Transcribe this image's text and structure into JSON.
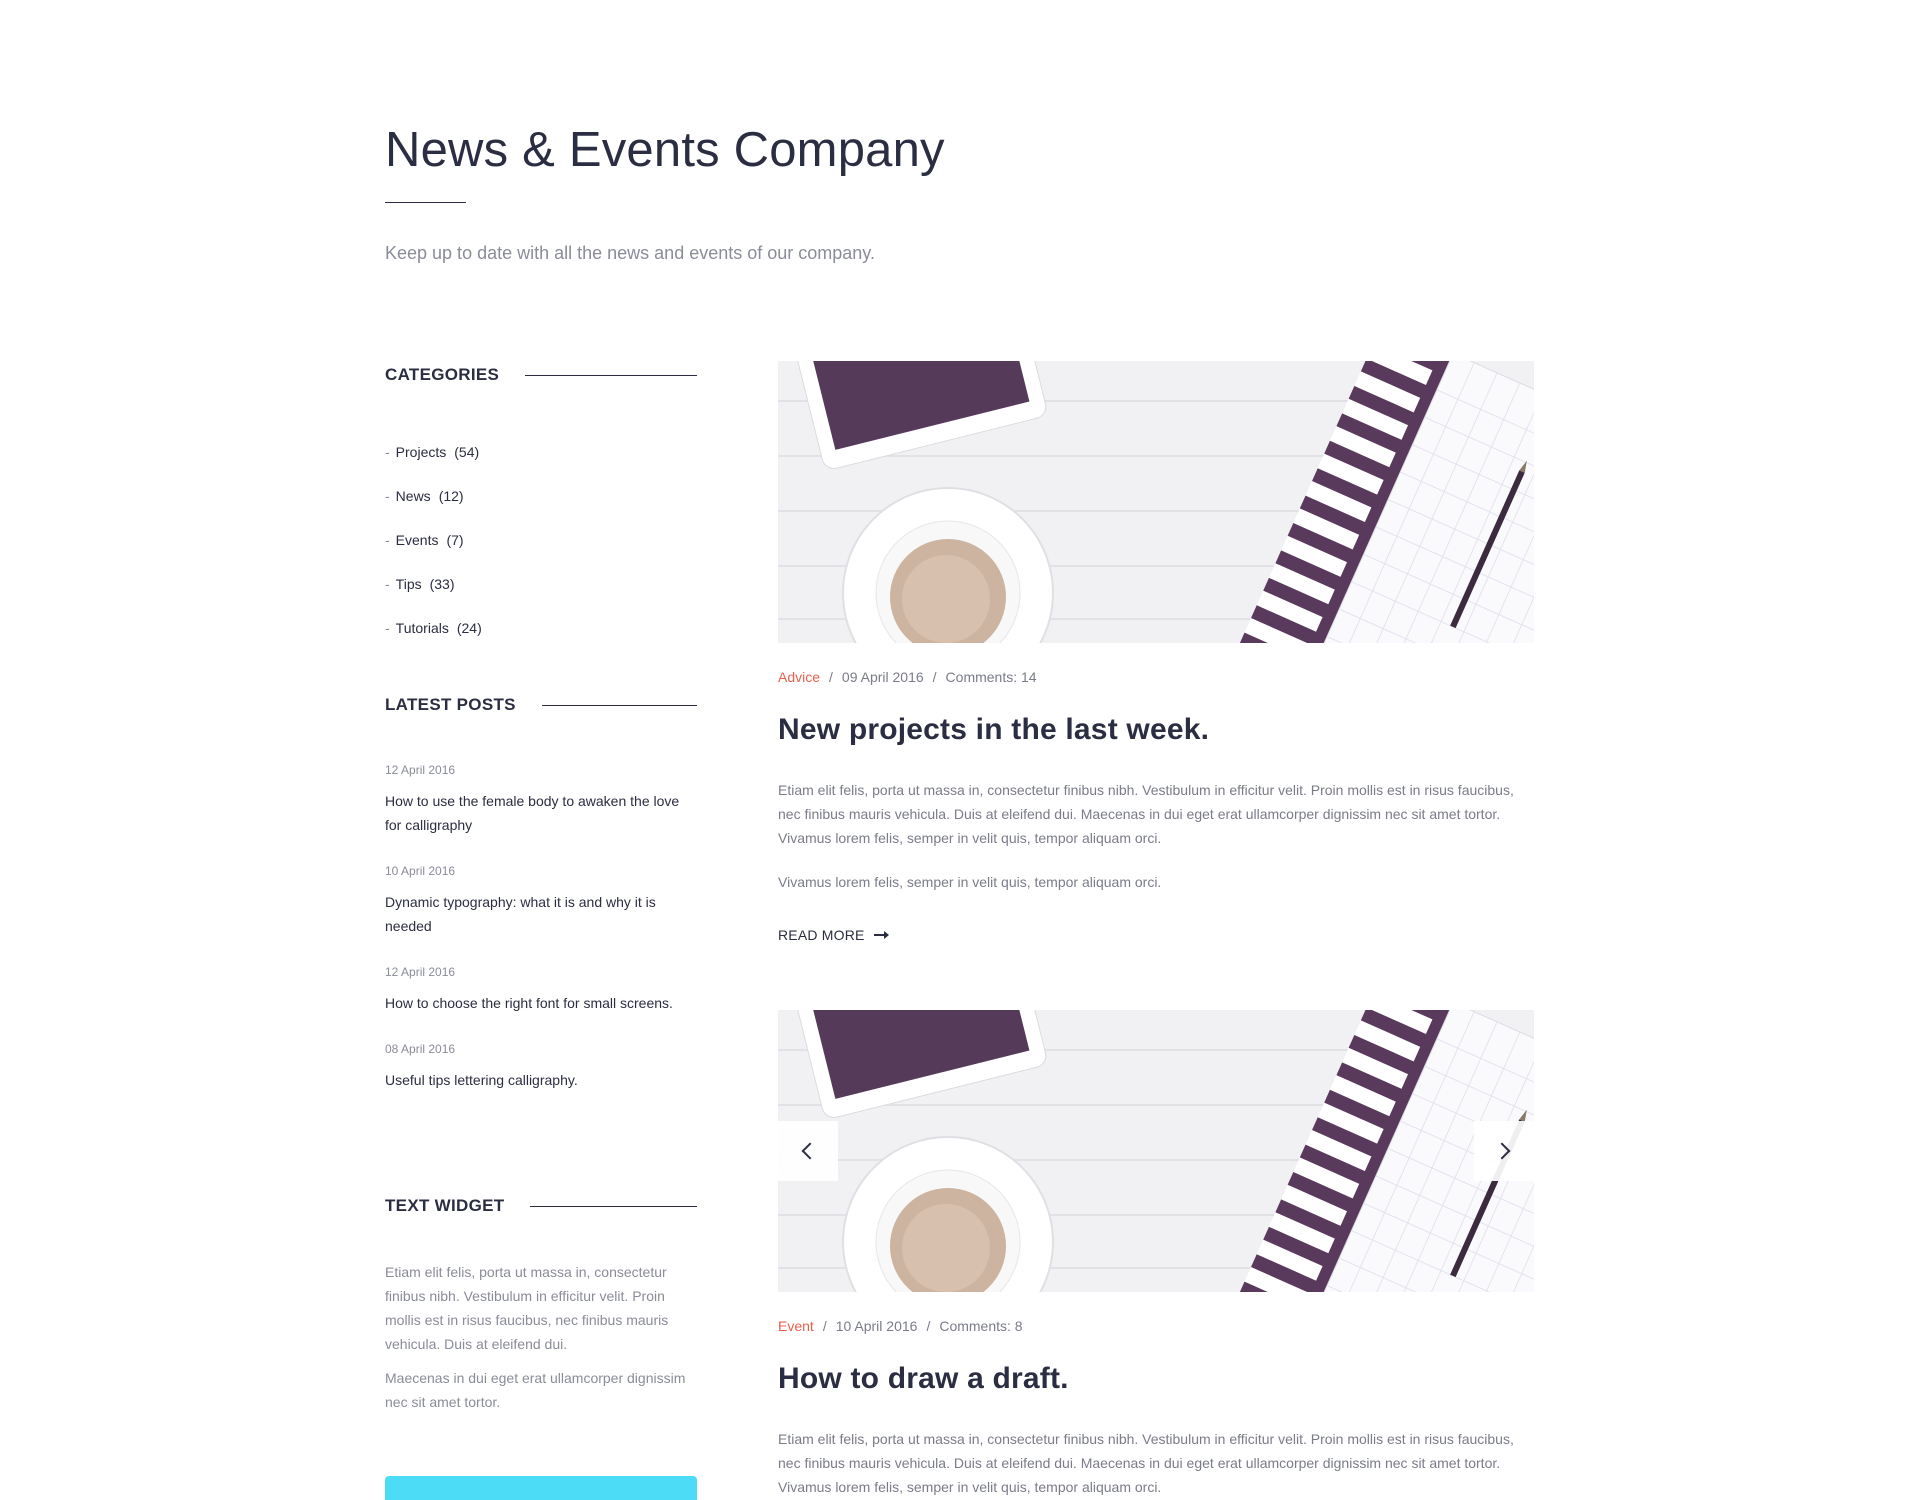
{
  "header": {
    "title": "News & Events Company",
    "subtitle": "Keep up to date with all the news and events of our company."
  },
  "sidebar": {
    "categories": {
      "title": "CATEGORIES",
      "items": [
        {
          "label": "Projects",
          "count": "(54)"
        },
        {
          "label": "News",
          "count": "(12)"
        },
        {
          "label": "Events",
          "count": "(7)"
        },
        {
          "label": "Tips",
          "count": "(33)"
        },
        {
          "label": "Tutorials",
          "count": "(24)"
        }
      ]
    },
    "latest_posts": {
      "title": "LATEST POSTS",
      "items": [
        {
          "date": "12 April 2016",
          "title": "How to use the female body to awaken the love for calligraphy"
        },
        {
          "date": "10 April 2016",
          "title": "Dynamic typography: what it is and why it is needed"
        },
        {
          "date": "12 April 2016",
          "title": "How to choose the right font for small screens."
        },
        {
          "date": "08 April 2016",
          "title": "Useful tips lettering calligraphy."
        }
      ]
    },
    "text_widget": {
      "title": "TEXT WIDGET",
      "p1": "Etiam elit felis, porta ut massa in, consectetur finibus nibh. Vestibulum in efficitur velit. Proin mollis est in risus faucibus, nec finibus mauris vehicula. Duis at eleifend dui.",
      "p2": "Maecenas in dui eget erat ullamcorper dignissim nec sit amet tortor."
    }
  },
  "articles": [
    {
      "category": "Advice",
      "date": "09 April 2016",
      "comments": "Comments: 14",
      "title": "New projects in the last week.",
      "body1": "Etiam elit felis, porta ut massa in, consectetur finibus nibh. Vestibulum in efficitur velit. Proin mollis est in risus faucibus, nec finibus mauris vehicula. Duis at eleifend dui. Maecenas in dui eget erat ullamcorper dignissim nec sit amet tortor. Vivamus lorem felis, semper in velit quis, tempor aliquam orci.",
      "body2": "Vivamus lorem felis, semper in velit quis, tempor aliquam orci.",
      "read_more": "READ MORE"
    },
    {
      "category": "Event",
      "date": "10 April 2016",
      "comments": "Comments: 8",
      "title": "How to draw a draft.",
      "body1": "Etiam elit felis, porta ut massa in, consectetur finibus nibh. Vestibulum in efficitur velit. Proin mollis est in risus faucibus, nec finibus mauris vehicula. Duis at eleifend dui. Maecenas in dui eget erat ullamcorper dignissim nec sit amet tortor. Vivamus lorem felis, semper in velit quis, tempor aliquam orci."
    }
  ],
  "colors": {
    "heading": "#2b2d42",
    "muted": "#8a8c99",
    "accent": "#e8604c",
    "cta": "#4ddcf5",
    "purple": "#5a3a5c"
  },
  "icons": {
    "read_more": "arrow-right-icon",
    "prev": "chevron-left-icon",
    "next": "chevron-right-icon"
  }
}
